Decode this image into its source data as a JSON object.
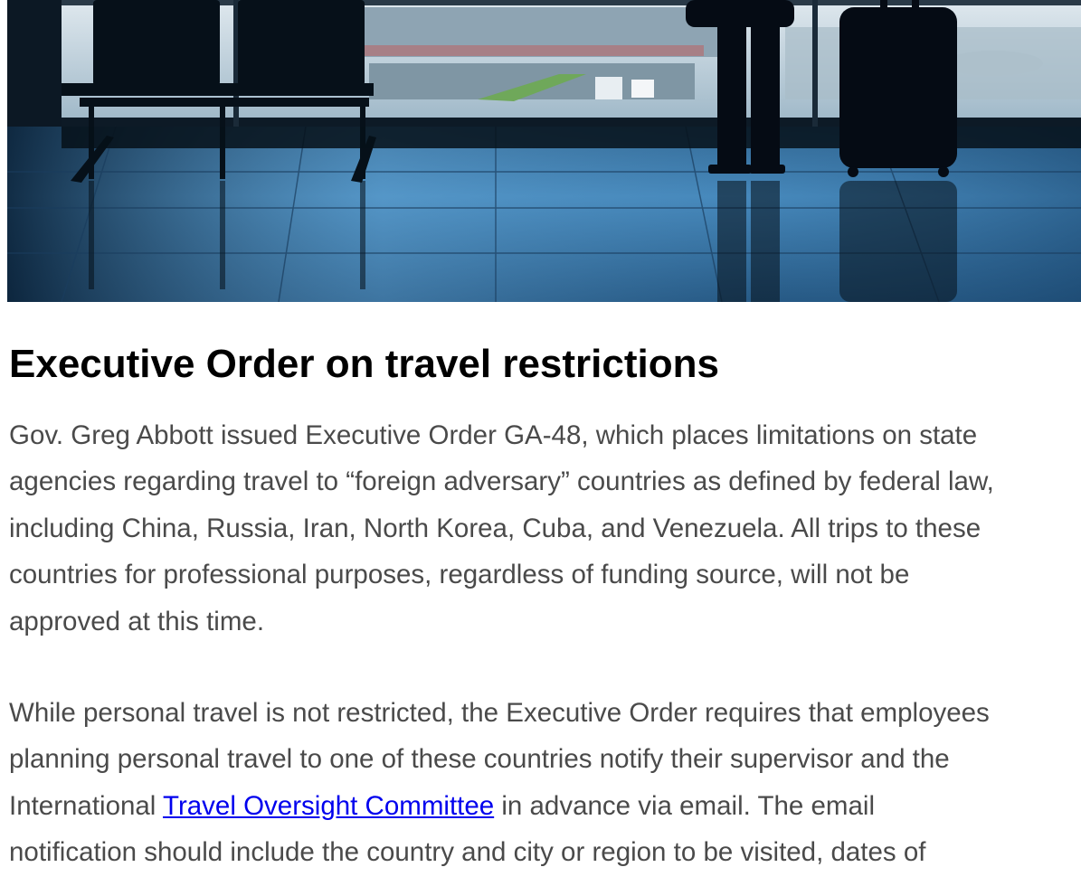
{
  "article": {
    "hero_image": {
      "description_icon": "airport-terminal-photo",
      "colors": {
        "sky": "#c9dbe6",
        "floor": "#3b7fb4",
        "silhouette": "#050b14"
      }
    },
    "title": "Executive Order on travel restrictions",
    "paragraph_1": {
      "lines": [
        "Gov. Greg Abbott issued Executive Order GA-48, which places limitations on state",
        "agencies regarding travel to “foreign adversary” countries as defined by federal law,",
        "including China, Russia, Iran, North Korea, Cuba, and Venezuela. All trips to these",
        "countries for professional purposes, regardless of funding source, will not be",
        "approved at this time."
      ]
    },
    "paragraph_2": {
      "line_1": "While personal travel is not restricted, the Executive Order requires that employees",
      "line_2": "planning personal travel to one of these countries notify their supervisor and the",
      "line_3_before_link": "International ",
      "link_text": "Travel Oversight Committee",
      "line_3_after_link": " in advance via email. The email",
      "line_4": "notification should include the country and city or region to be visited, dates of"
    },
    "colors": {
      "heading": "#000000",
      "body_text": "#4a4a4a",
      "link": "#0000ee"
    }
  }
}
